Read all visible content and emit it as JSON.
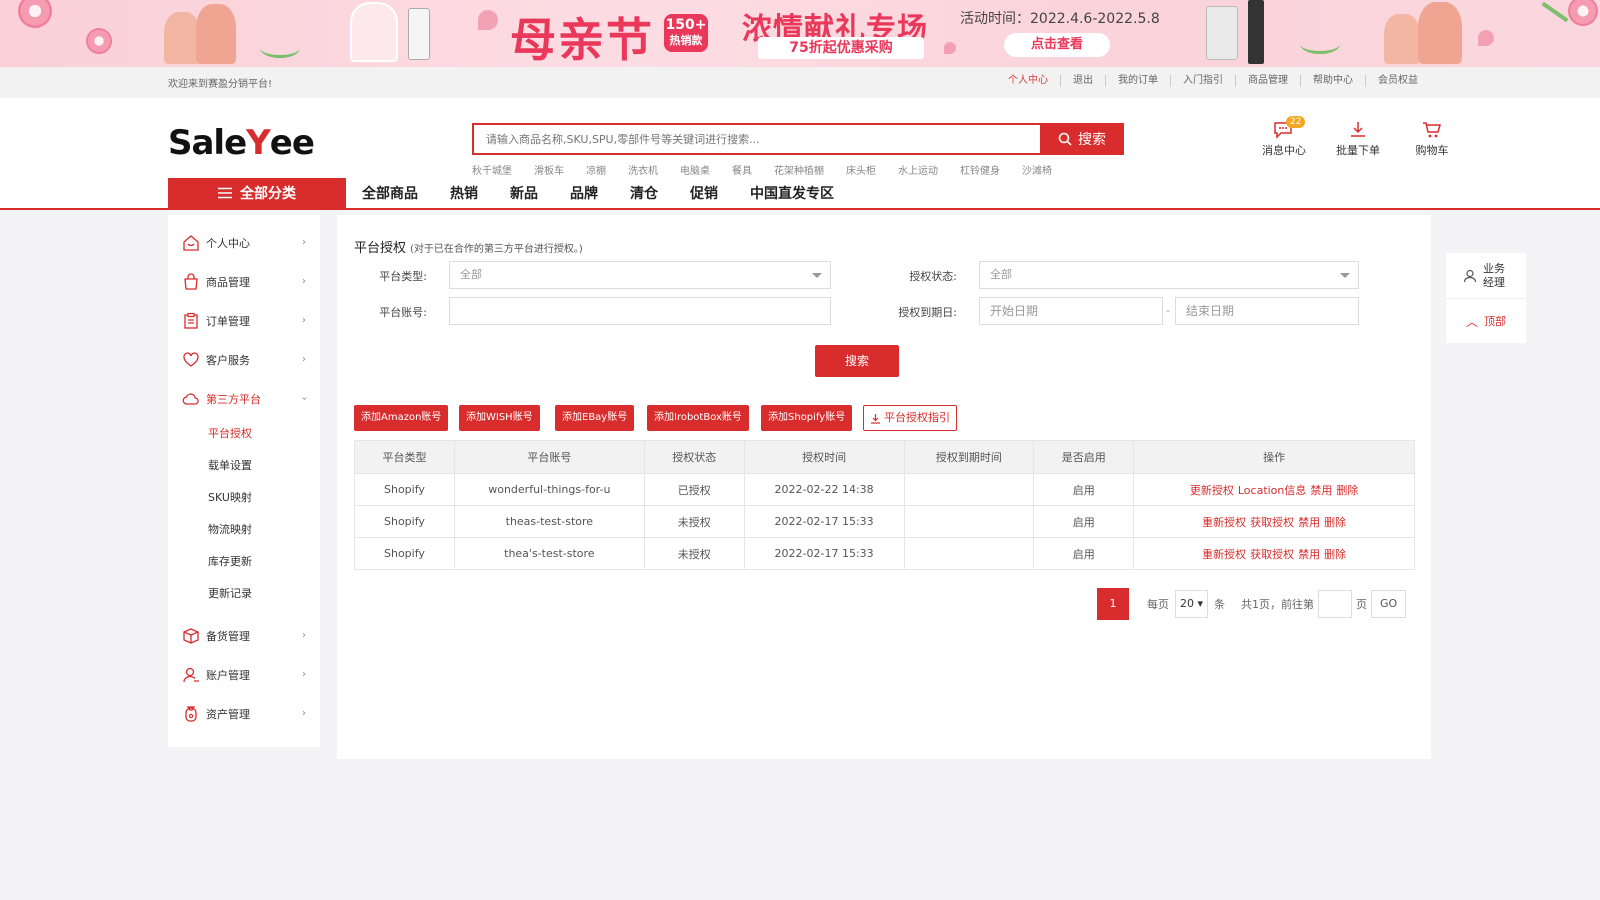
{
  "banner": {
    "title_main": "母亲节",
    "badge_num": "150+",
    "badge_text": "热销款",
    "title_sub": "浓情献礼专场",
    "discount": "75折起优惠采购",
    "period": "活动时间：2022.4.6-2022.5.8",
    "cta": "点击查看"
  },
  "topbar": {
    "welcome": "欢迎来到赛盈分销平台!",
    "links": [
      "个人中心",
      "退出",
      "我的订单",
      "入门指引",
      "商品管理",
      "帮助中心",
      "会员权益"
    ]
  },
  "header": {
    "logo_a": "Sale",
    "logo_b": "Y",
    "logo_c": "ee",
    "search_placeholder": "请输入商品名称,SKU,SPU,零部件号等关键词进行搜索...",
    "search_btn": "搜索",
    "hotwords": [
      "秋千城堡",
      "滑板车",
      "凉棚",
      "洗衣机",
      "电脑桌",
      "餐具",
      "花架种植棚",
      "床头柜",
      "水上运动",
      "杠铃健身",
      "沙滩椅"
    ],
    "icons": [
      {
        "label": "消息中心",
        "badge": "22",
        "icon": "message-icon"
      },
      {
        "label": "批量下单",
        "icon": "download-icon"
      },
      {
        "label": "购物车",
        "icon": "cart-icon"
      }
    ],
    "allcat": "全部分类",
    "nav": [
      "全部商品",
      "热销",
      "新品",
      "品牌",
      "清仓",
      "促销",
      "中国直发专区"
    ]
  },
  "sidebar": {
    "items": [
      {
        "label": "个人中心",
        "icon": "home-icon"
      },
      {
        "label": "商品管理",
        "icon": "bag-icon"
      },
      {
        "label": "订单管理",
        "icon": "clipboard-icon"
      },
      {
        "label": "客户服务",
        "icon": "heart-icon"
      },
      {
        "label": "第三方平台",
        "icon": "cloud-icon"
      }
    ],
    "sub": [
      "平台授权",
      "载单设置",
      "SKU映射",
      "物流映射",
      "库存更新",
      "更新记录"
    ],
    "items2": [
      {
        "label": "备货管理",
        "icon": "box-icon"
      },
      {
        "label": "账户管理",
        "icon": "user-icon"
      },
      {
        "label": "资产管理",
        "icon": "moneybag-icon"
      }
    ]
  },
  "panel": {
    "title": "平台授权",
    "title_note": "(对于已在合作的第三方平台进行授权。)",
    "f_type_label": "平台类型:",
    "f_type_value": "全部",
    "f_status_label": "授权状态:",
    "f_status_value": "全部",
    "f_account_label": "平台账号:",
    "f_account_value": "",
    "f_expire_label": "授权到期日:",
    "f_start_ph": "开始日期",
    "f_end_ph": "结束日期",
    "date_sep": "-",
    "search_btn": "搜索",
    "add_buttons": [
      "添加Amazon账号",
      "添加WISH账号",
      "添加EBay账号",
      "添加IrobotBox账号",
      "添加Shopify账号"
    ],
    "guide_btn": "平台授权指引",
    "columns": [
      "平台类型",
      "平台账号",
      "授权状态",
      "授权时间",
      "授权到期时间",
      "是否启用",
      "操作"
    ],
    "rows": [
      {
        "type": "Shopify",
        "account": "wonderful-things-for-u",
        "status": "已授权",
        "time": "2022-02-22 14:38",
        "expire": "",
        "enabled": "启用",
        "ops": [
          "更新授权",
          "Location信息",
          "禁用",
          "删除"
        ]
      },
      {
        "type": "Shopify",
        "account": "theas-test-store",
        "status": "未授权",
        "time": "2022-02-17 15:33",
        "expire": "",
        "enabled": "启用",
        "ops": [
          "重新授权",
          "获取授权",
          "禁用",
          "删除"
        ]
      },
      {
        "type": "Shopify",
        "account": "thea's-test-store",
        "status": "未授权",
        "time": "2022-02-17 15:33",
        "expire": "",
        "enabled": "启用",
        "ops": [
          "重新授权",
          "获取授权",
          "禁用",
          "删除"
        ]
      }
    ],
    "pager": {
      "current": "1",
      "per_page_label": "每页",
      "per_page": "20",
      "unit": "条",
      "total": "共1页，前往第",
      "page_unit": "页",
      "go": "GO"
    }
  },
  "float": {
    "manager": "业务经理",
    "top": "顶部"
  },
  "colors": {
    "accent": "#d92c2c",
    "banner_pink": "#fbd0d8"
  }
}
